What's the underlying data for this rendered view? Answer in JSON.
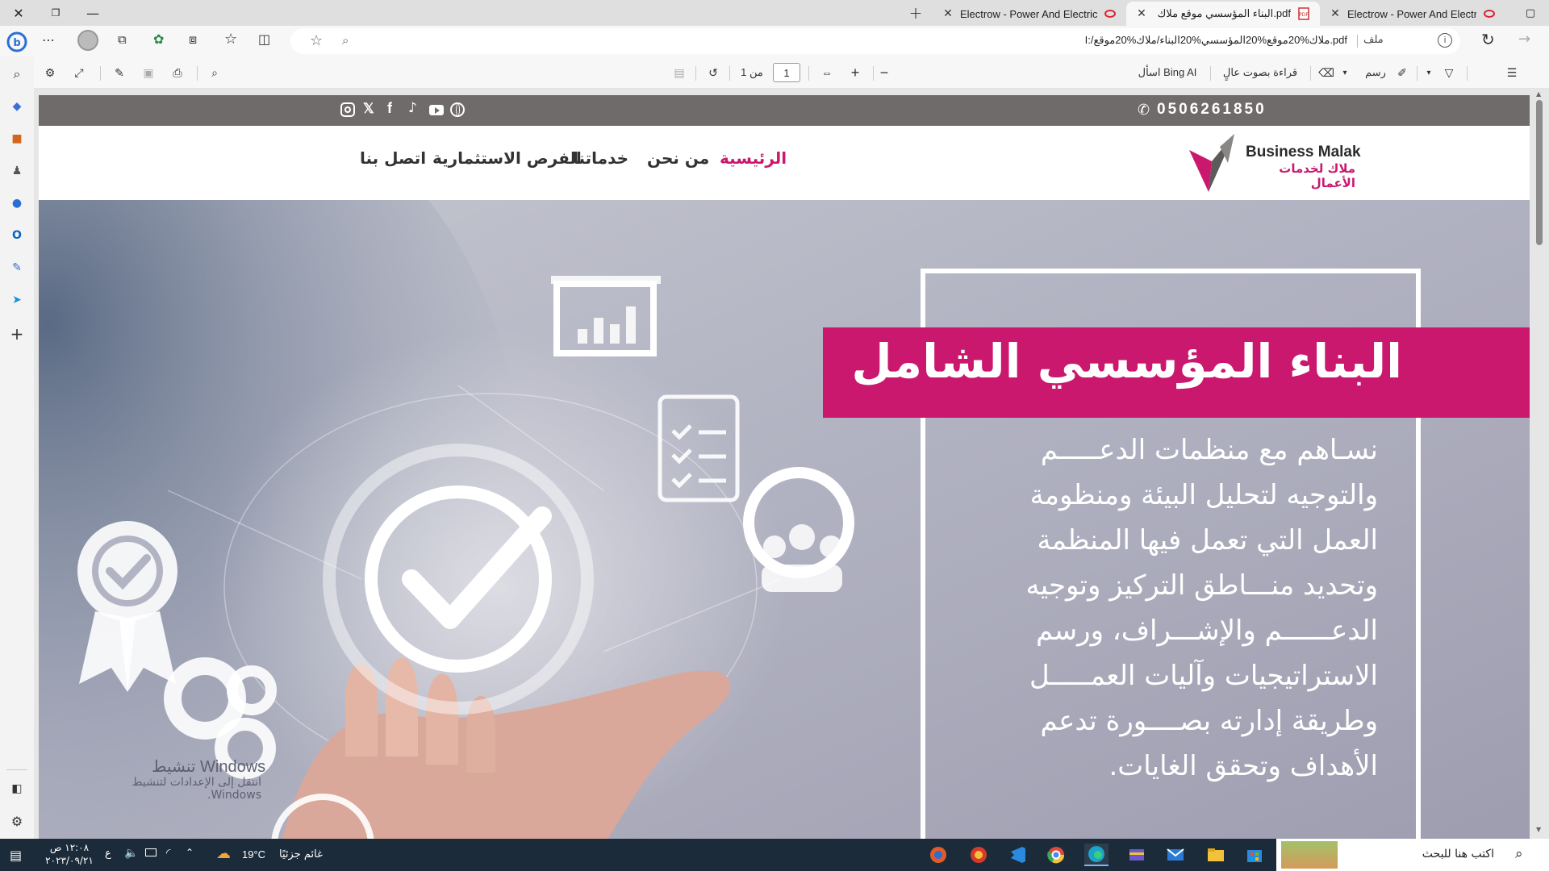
{
  "browser": {
    "tabs": [
      {
        "title": "Electrow - Power And Electricity S",
        "active": false
      },
      {
        "title": "البناء المؤسسي موقع ملاك.pdf",
        "active": true
      },
      {
        "title": "Electrow - Power And Electricity S",
        "active": false
      }
    ],
    "url": "I:/ملاك%20موقع%20المؤسسي%20البناء/ملاك%20موقع.pdf",
    "file_label": "ملف"
  },
  "pdf_toolbar": {
    "draw_label": "رسم",
    "read_aloud_label": "قراءة بصوت عالٍ",
    "ask_bing_label": "اسأل Bing AI",
    "page_current": "1",
    "page_of": "من 1"
  },
  "site": {
    "phone": "0506261850",
    "brand_en": "Business Malak",
    "brand_ar": "ملاك لخدمات الأعمال",
    "nav": [
      "الرئيسية",
      "من نحن",
      "خدماتنا",
      "الفرص الاستثمارية",
      "اتصل بنا"
    ],
    "hero_title": "البناء المؤسسي الشامل",
    "hero_lines": [
      "نسـاهم مع منظمات الدعـــــم",
      "والتوجيه لتحليل البيئة ومنظومة",
      "العمل التي تعمل فيها المنظمة",
      "وتحديد منـــاطق التركيز وتوجيه",
      "الدعــــــم والإشـــراف، ورسم",
      "الاستراتيجيات وآليات العمـــــل",
      "وطريقة إدارته بصــــورة تدعم",
      "الأهداف وتحقق الغايات."
    ]
  },
  "watermark": {
    "title": "Windows تنشيط",
    "subtitle": "انتقل إلى الإعدادات لتنشيط Windows."
  },
  "taskbar": {
    "search_placeholder": "اكتب هنا للبحث",
    "weather": "غائم جزئيًا",
    "temperature": "19°C",
    "time": "١٢:٠٨ ص",
    "date": "٢٠٢٣/٠٩/٢١",
    "lang": "ع"
  },
  "colors": {
    "accent": "#c9186e",
    "topstrip": "#6f6b6a",
    "hero_bg": "#a9a8b8",
    "taskbar": "#1c2b39"
  }
}
